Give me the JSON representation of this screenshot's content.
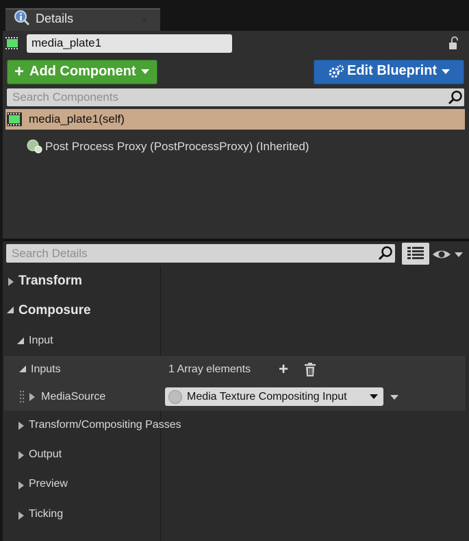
{
  "tab": {
    "title": "Details",
    "icon": "magnifier-icon",
    "close_glyph": "×"
  },
  "actor": {
    "name": "media_plate1",
    "icon": "actor-film-icon",
    "lock_icon": "lock-open-icon"
  },
  "toolbar": {
    "add_component": {
      "plus": "+",
      "label": "Add Component",
      "color": "#4aa134"
    },
    "edit_blueprint": {
      "label": "Edit Blueprint",
      "color": "#2767b5"
    }
  },
  "components_search": {
    "placeholder": "Search Components"
  },
  "components": [
    {
      "label": "media_plate1(self)",
      "selected": true,
      "highlight": "#c9a98a"
    },
    {
      "label": "Post Process Proxy (PostProcessProxy) (Inherited)",
      "selected": false
    }
  ],
  "details_search": {
    "placeholder": "Search Details"
  },
  "details": {
    "transform": {
      "label": "Transform",
      "expanded": false
    },
    "composure": {
      "label": "Composure",
      "expanded": true
    },
    "input": {
      "label": "Input",
      "expanded": true
    },
    "inputs": {
      "label": "Inputs",
      "count_label": "1 Array elements",
      "add_glyph": "+"
    },
    "media_source": {
      "label": "MediaSource",
      "value": "Media Texture Compositing Input"
    },
    "transform_passes": {
      "label": "Transform/Compositing Passes"
    },
    "output": {
      "label": "Output"
    },
    "preview": {
      "label": "Preview"
    },
    "ticking": {
      "label": "Ticking"
    }
  }
}
